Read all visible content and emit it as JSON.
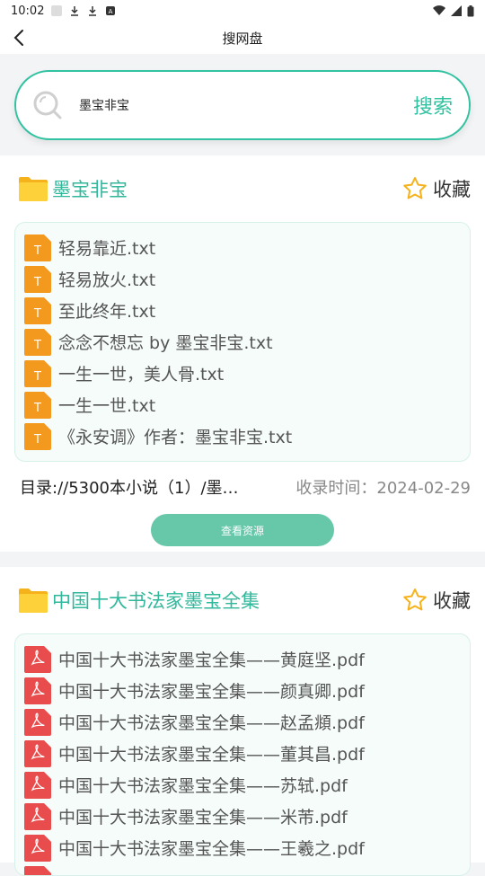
{
  "status": {
    "time": "10:02"
  },
  "nav": {
    "title": "搜网盘"
  },
  "search": {
    "query": "墨宝非宝",
    "button": "搜索"
  },
  "results": [
    {
      "title": "墨宝非宝",
      "fav_label": "收藏",
      "file_type": "txt",
      "files": [
        "轻易靠近.txt",
        "轻易放火.txt",
        "至此终年.txt",
        "念念不想忘 by 墨宝非宝.txt",
        "一生一世，美人骨.txt",
        "一生一世.txt",
        "《永安调》作者：墨宝非宝.txt"
      ],
      "path": "目录://5300本小说（1）/墨…",
      "time": "收录时间：2024-02-29",
      "view_button": "查看资源"
    },
    {
      "title": "中国十大书法家墨宝全集",
      "fav_label": "收藏",
      "file_type": "pdf",
      "files": [
        "中国十大书法家墨宝全集——黄庭坚.pdf",
        "中国十大书法家墨宝全集——颜真卿.pdf",
        "中国十大书法家墨宝全集——赵孟頫.pdf",
        "中国十大书法家墨宝全集——董其昌.pdf",
        "中国十大书法家墨宝全集——苏轼.pdf",
        "中国十大书法家墨宝全集——米芾.pdf",
        "中国十大书法家墨宝全集——王羲之.pdf"
      ]
    }
  ],
  "colors": {
    "accent": "#31c2a1",
    "title": "#31b79b",
    "button": "#66c7a9",
    "txt_icon": "#f39a1e",
    "pdf_icon": "#e84c4c"
  }
}
